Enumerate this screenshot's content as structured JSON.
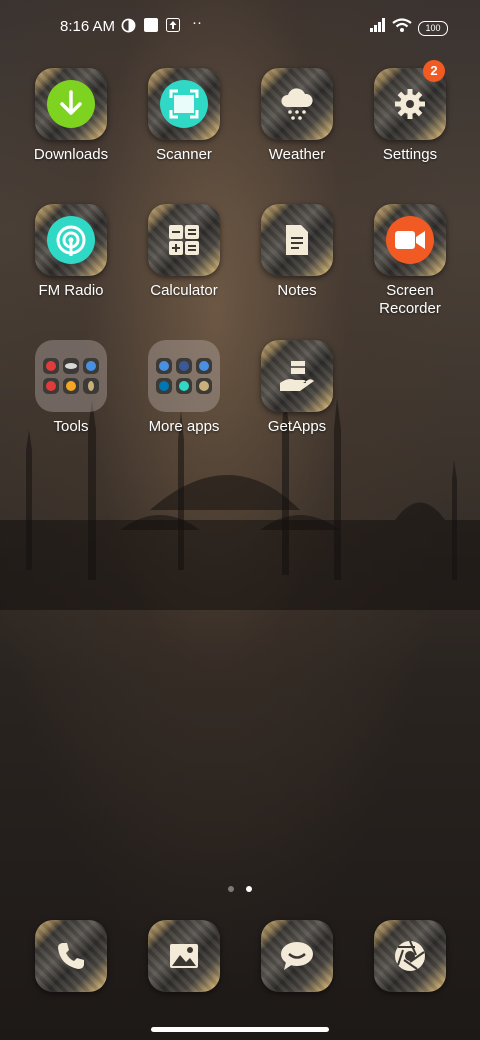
{
  "status": {
    "time": "8:16 AM",
    "battery": "100"
  },
  "apps": [
    {
      "label": "Downloads"
    },
    {
      "label": "Scanner"
    },
    {
      "label": "Weather"
    },
    {
      "label": "Settings",
      "badge": "2"
    },
    {
      "label": "FM Radio"
    },
    {
      "label": "Calculator"
    },
    {
      "label": "Notes"
    },
    {
      "label": "Screen Recorder"
    },
    {
      "label": "Tools"
    },
    {
      "label": "More apps"
    },
    {
      "label": "GetApps"
    }
  ],
  "dock": [
    {
      "icon": "phone-icon"
    },
    {
      "icon": "gallery-icon"
    },
    {
      "icon": "messages-icon"
    },
    {
      "icon": "camera-icon"
    }
  ],
  "colors": {
    "downloads": "#7ed321",
    "scanner": "#2fd9c5",
    "fmradio": "#2fd9c5",
    "recorder": "#f15a22",
    "badge": "#f15a22"
  }
}
